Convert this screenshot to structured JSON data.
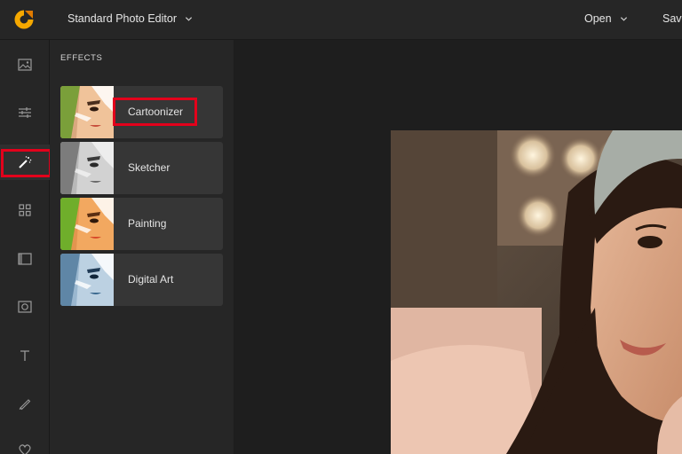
{
  "topbar": {
    "app_title": "Standard Photo Editor",
    "open_label": "Open",
    "save_label": "Save"
  },
  "rail": {
    "items": [
      {
        "icon": "image-icon"
      },
      {
        "icon": "sliders-icon"
      },
      {
        "icon": "magic-wand-icon",
        "active": true
      },
      {
        "icon": "grid-icon"
      },
      {
        "icon": "frame-icon"
      },
      {
        "icon": "overlay-icon"
      },
      {
        "icon": "text-icon",
        "glyph": "T"
      },
      {
        "icon": "brush-icon"
      },
      {
        "icon": "heart-icon"
      }
    ]
  },
  "panel": {
    "title": "EFFECTS",
    "effects": [
      {
        "label": "Cartoonizer"
      },
      {
        "label": "Sketcher"
      },
      {
        "label": "Painting"
      },
      {
        "label": "Digital Art"
      }
    ]
  },
  "colors": {
    "accent": "#f5a800",
    "highlight": "#e3001b",
    "panel_bg": "#262626",
    "card_bg": "#363636"
  }
}
